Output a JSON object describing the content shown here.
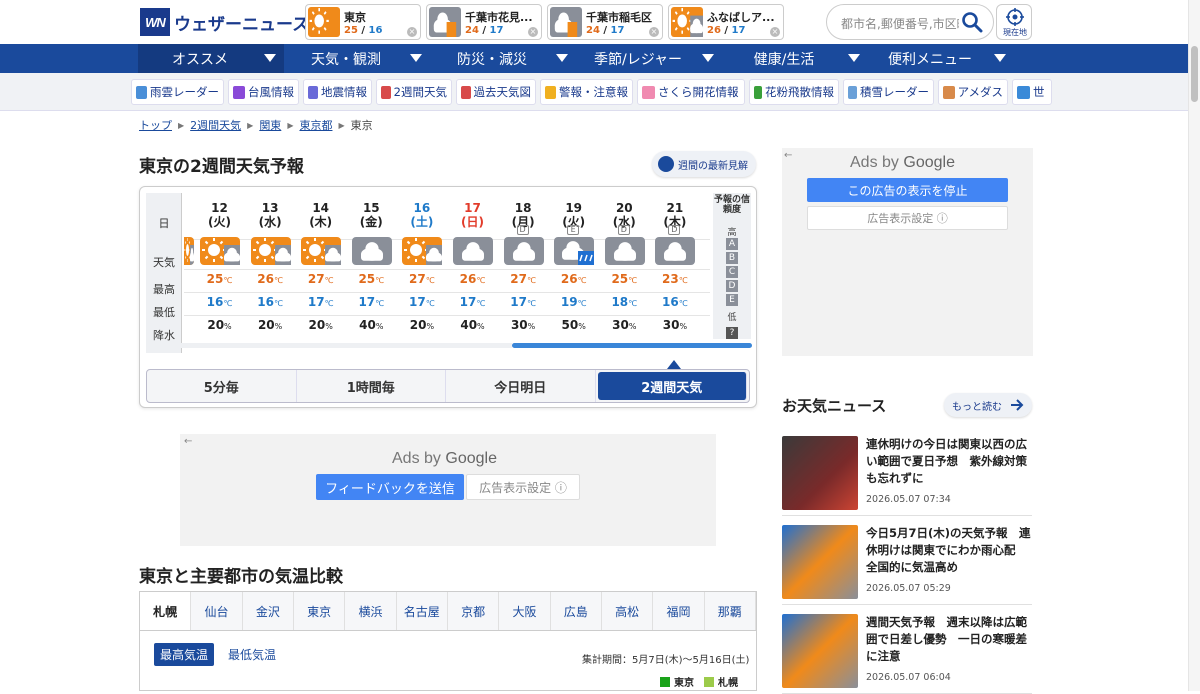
{
  "header": {
    "logo_mark": "WN",
    "logo_text": "ウェザーニュース",
    "cities": [
      {
        "name": "東京",
        "max": "25",
        "min": "16",
        "icon": "sunny-icon"
      },
      {
        "name": "千葉市花見...",
        "max": "24",
        "min": "17",
        "icon": "cloudy-sunny-icon"
      },
      {
        "name": "千葉市稲毛区",
        "max": "24",
        "min": "17",
        "icon": "cloudy-sunny-icon"
      },
      {
        "name": "ふなばしア...",
        "max": "26",
        "min": "17",
        "icon": "sunny-cloudy-icon"
      }
    ],
    "search_placeholder": "都市名,郵便番号,市区町村",
    "location_label": "現在地"
  },
  "main_nav": [
    "オススメ",
    "天気・観測",
    "防災・減災",
    "季節/レジャー",
    "健康/生活",
    "便利メニュー"
  ],
  "sub_nav": [
    "雨雲レーダー",
    "台風情報",
    "地震情報",
    "2週間天気",
    "過去天気図",
    "警報・注意報",
    "さくら開花情報",
    "花粉飛散情報",
    "積雪レーダー",
    "アメダス",
    "世"
  ],
  "breadcrumb": {
    "items": [
      "トップ",
      "2週間天気",
      "関東",
      "東京都"
    ],
    "current": "東京"
  },
  "forecast": {
    "title": "東京の2週間天気予報",
    "latest_button": "週間の最新見解",
    "row_labels": {
      "day": "日",
      "weather": "天気",
      "max": "最高",
      "min": "最低",
      "pop": "降水"
    },
    "unit_c": "℃",
    "unit_pct": "%",
    "days": [
      {
        "date": "12",
        "dow": "(火)",
        "rel": "",
        "icon": "sunny-cloudy-icon",
        "max": "25",
        "min": "16",
        "pop": "20"
      },
      {
        "date": "13",
        "dow": "(水)",
        "rel": "",
        "icon": "sunny-cloudy-icon",
        "max": "26",
        "min": "16",
        "pop": "20"
      },
      {
        "date": "14",
        "dow": "(木)",
        "rel": "",
        "icon": "sunny-cloudy-icon",
        "max": "27",
        "min": "17",
        "pop": "20"
      },
      {
        "date": "15",
        "dow": "(金)",
        "rel": "",
        "icon": "cloudy-icon",
        "max": "25",
        "min": "17",
        "pop": "40"
      },
      {
        "date": "16",
        "dow": "(土)",
        "rel": "",
        "icon": "sunny-cloudy-icon",
        "max": "27",
        "min": "17",
        "pop": "20"
      },
      {
        "date": "17",
        "dow": "(日)",
        "rel": "",
        "icon": "cloudy-icon",
        "max": "26",
        "min": "17",
        "pop": "40"
      },
      {
        "date": "18",
        "dow": "(月)",
        "rel": "D",
        "icon": "cloudy-icon",
        "max": "27",
        "min": "17",
        "pop": "30"
      },
      {
        "date": "19",
        "dow": "(火)",
        "rel": "E",
        "icon": "cloudy-rain-icon",
        "max": "26",
        "min": "19",
        "pop": "50"
      },
      {
        "date": "20",
        "dow": "(水)",
        "rel": "D",
        "icon": "cloudy-icon",
        "max": "25",
        "min": "18",
        "pop": "30"
      },
      {
        "date": "21",
        "dow": "(木)",
        "rel": "D",
        "icon": "cloudy-icon",
        "max": "23",
        "min": "16",
        "pop": "30"
      }
    ],
    "reliability": {
      "header": "予報の信頼度",
      "high": "高",
      "low": "低",
      "grades": [
        "A",
        "B",
        "C",
        "D",
        "E"
      ],
      "help": "?"
    },
    "tabs": [
      "5分毎",
      "1時間毎",
      "今日明日",
      "2週間天気"
    ],
    "active_tab": 3
  },
  "ads": {
    "right": {
      "back": "←",
      "by": "Ads by",
      "google": "Google",
      "stop": "この広告の表示を停止",
      "settings": "広告表示設定",
      "info": "ⓘ"
    },
    "center": {
      "back": "←",
      "by": "Ads by",
      "google": "Google",
      "feedback": "フィードバックを送信",
      "settings": "広告表示設定",
      "info": "ⓘ"
    }
  },
  "compare": {
    "title": "東京と主要都市の気温比較",
    "cities": [
      "札幌",
      "仙台",
      "金沢",
      "東京",
      "横浜",
      "名古屋",
      "京都",
      "大阪",
      "広島",
      "高松",
      "福岡",
      "那覇"
    ],
    "active_city": 0,
    "max_label": "最高気温",
    "min_label": "最低気温",
    "period": "集計期間：5月7日(木)〜5月16日(土)",
    "legend": [
      {
        "name": "東京",
        "color": "#1aa31a"
      },
      {
        "name": "札幌",
        "color": "#9ccb4a"
      }
    ]
  },
  "news": {
    "title": "お天気ニュース",
    "more": "もっと読む",
    "items": [
      {
        "title": "連休明けの今日は関東以西の広い範囲で夏日予想　紫外線対策も忘れずに",
        "date": "2026.05.07 07:34"
      },
      {
        "title": "今日5月7日(木)の天気予報　連休明けは関東でにわか雨心配　全国的に気温高め",
        "date": "2026.05.07 05:29"
      },
      {
        "title": "週間天気予報　週末以降は広範囲で日差し優勢　一日の寒暖差に注意",
        "date": "2026.05.07 06:04"
      }
    ]
  },
  "colors": {
    "brand": "#1a4a9c",
    "max_temp": "#e06a1b",
    "min_temp": "#1f7ac9",
    "sunday": "#e23b2a"
  }
}
